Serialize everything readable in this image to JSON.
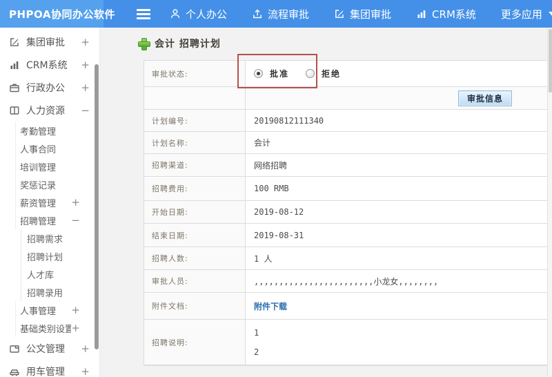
{
  "colors": {
    "header_bg": "#4490e8",
    "logo_bg": "#56a1ee",
    "accent_green": "#62b046",
    "link_blue": "#2b6dad",
    "annotation_red": "#b4504c",
    "button_blue": "#bcdcf5"
  },
  "header": {
    "logo": "PHPOA协同办公软件",
    "menu_icon": "hamburger-icon",
    "nav": [
      {
        "id": "personal-office",
        "icon": "person-icon",
        "label": "个人办公"
      },
      {
        "id": "workflow-approval",
        "icon": "upload-icon",
        "label": "流程审批"
      },
      {
        "id": "group-approval",
        "icon": "edit-icon",
        "label": "集团审批"
      },
      {
        "id": "crm-system",
        "icon": "chart-icon",
        "label": "CRM系统"
      },
      {
        "id": "more-apps",
        "icon": "caret-down-icon",
        "label": "更多应用"
      }
    ]
  },
  "sidebar": {
    "items": [
      {
        "id": "group-approval",
        "label": "集团审批",
        "level": 1,
        "icon": "edit-icon",
        "toggle": "+"
      },
      {
        "id": "crm-system",
        "label": "CRM系统",
        "level": 1,
        "icon": "chart-icon",
        "toggle": "+"
      },
      {
        "id": "admin-office",
        "label": "行政办公",
        "level": 1,
        "icon": "briefcase-icon",
        "toggle": "+"
      },
      {
        "id": "human-resources",
        "label": "人力资源",
        "level": 1,
        "icon": "book-icon",
        "toggle": "−"
      },
      {
        "id": "attendance",
        "label": "考勤管理",
        "level": 2
      },
      {
        "id": "hr-contract",
        "label": "人事合同",
        "level": 2
      },
      {
        "id": "training",
        "label": "培训管理",
        "level": 2
      },
      {
        "id": "reward-punish",
        "label": "奖惩记录",
        "level": 2
      },
      {
        "id": "salary",
        "label": "薪资管理",
        "level": 2,
        "toggle": "+"
      },
      {
        "id": "recruitment",
        "label": "招聘管理",
        "level": 2,
        "toggle": "−"
      },
      {
        "id": "recruit-demand",
        "label": "招聘需求",
        "level": 3
      },
      {
        "id": "recruit-plan",
        "label": "招聘计划",
        "level": 3
      },
      {
        "id": "talent-pool",
        "label": "人才库",
        "level": 3
      },
      {
        "id": "recruit-hire",
        "label": "招聘录用",
        "level": 3
      },
      {
        "id": "personnel",
        "label": "人事管理",
        "level": 2,
        "toggle": "+"
      },
      {
        "id": "base-category",
        "label": "基础类别设置",
        "level": 2,
        "toggle": "+"
      },
      {
        "id": "doc-management",
        "label": "公文管理",
        "level": 1,
        "icon": "doc-icon",
        "toggle": "+"
      },
      {
        "id": "vehicle",
        "label": "用车管理",
        "level": 1,
        "icon": "car-icon",
        "toggle": "+"
      }
    ]
  },
  "main": {
    "title": "会计 招聘计划",
    "title_icon": "plus-icon",
    "approval_status": {
      "label": "审批状态:",
      "options": [
        {
          "label": "批准",
          "checked": true
        },
        {
          "label": "拒绝",
          "checked": false
        }
      ]
    },
    "approval_info_button": "审批信息",
    "fields": [
      {
        "label": "计划编号:",
        "value": "20190812111340"
      },
      {
        "label": "计划名称:",
        "value": "会计"
      },
      {
        "label": "招聘渠道:",
        "value": "网络招聘"
      },
      {
        "label": "招聘费用:",
        "value": "100 RMB"
      },
      {
        "label": "开始日期:",
        "value": "2019-08-12"
      },
      {
        "label": "结束日期:",
        "value": "2019-08-31"
      },
      {
        "label": "招聘人数:",
        "value": "1 人"
      },
      {
        "label": "审批人员:",
        "value": ",,,,,,,,,,,,,,,,,,,,,,,,小龙女,,,,,,,,"
      },
      {
        "label": "附件文档:",
        "value": "附件下载",
        "link": true
      }
    ],
    "description_field": {
      "label": "招聘说明:",
      "lines": [
        "1",
        "2"
      ]
    }
  }
}
